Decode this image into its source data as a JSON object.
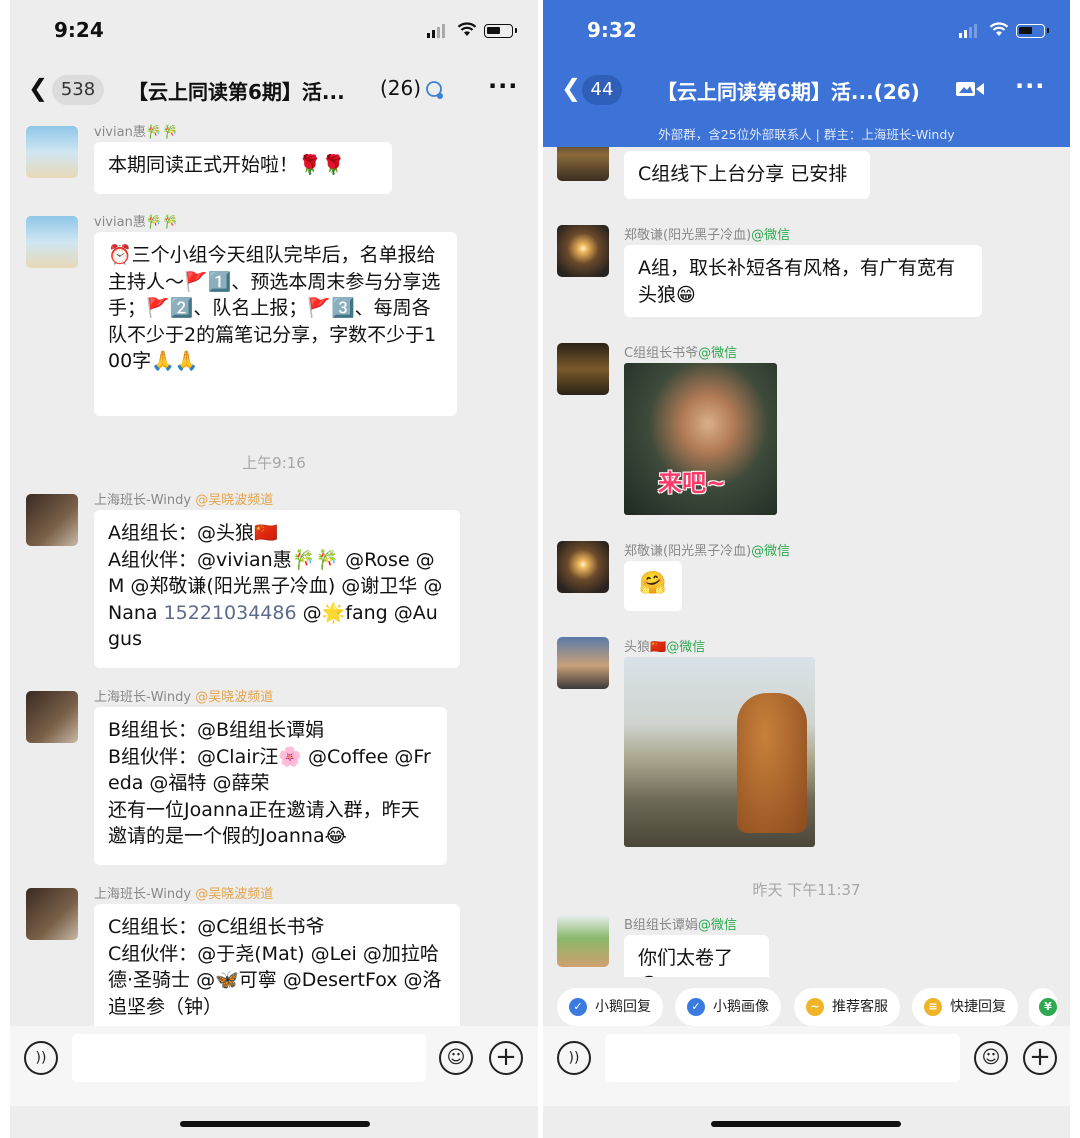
{
  "left": {
    "status": {
      "time": "9:24"
    },
    "nav": {
      "back_count": "538",
      "title": "【云上同读第6期】活...",
      "member_count": "(26)",
      "more": "···"
    },
    "messages": [
      {
        "sender": "vivian惠🎋🎋",
        "text": "本期同读正式开始啦！🌹🌹"
      },
      {
        "sender": "vivian惠🎋🎋",
        "text": "⏰三个小组今天组队完毕后，名单报给主持人～🚩1️⃣、预选本周末参与分享选手；🚩2️⃣、队名上报；🚩3️⃣、每周各队不少于2的篇笔记分享，字数不少于100字🙏🙏"
      },
      {
        "sender": "上海班长-Windy",
        "tag": "@吴晓波频道",
        "lines": [
          "A组组长：@头狼🇨🇳",
          "A组伙伴：@vivian惠🎋🎋 @Rose @M @郑敬谦(阳光黑子冷血) @谢卫华 @Nana "
        ],
        "phone": "15221034486",
        "tail": " @🌟fang @Augus"
      },
      {
        "sender": "上海班长-Windy",
        "tag": "@吴晓波频道",
        "text": "B组组长：@B组组长谭娟\nB组伙伴：@Clair汪🌸 @Coffee @Freda @福特 @薛荣\n还有一位Joanna正在邀请入群，昨天邀请的是一个假的Joanna😂"
      },
      {
        "sender": "上海班长-Windy",
        "tag": "@吴晓波频道",
        "text": "C组组长：@C组组长书爷\nC组伙伴：@于尧(Mat) @Lei @加拉哈德·圣骑士 @🦋可寧 @DesertFox @洛追坚参（钟）"
      }
    ],
    "timestamp": "上午9:16"
  },
  "right": {
    "status": {
      "time": "9:32"
    },
    "nav": {
      "back_count": "44",
      "title": "【云上同读第6期】活...(26)",
      "subtitle": "外部群，含25位外部联系人 | 群主：上海班长-Windy"
    },
    "messages": [
      {
        "text": "C组线下上台分享 已安排"
      },
      {
        "sender": "郑敬谦(阳光黑子冷血)",
        "wx": "@微信",
        "text": "A组，取长补短各有风格，有广有宽有头狼😁"
      },
      {
        "sender": "C组组长书爷",
        "wx": "@微信",
        "sticker_caption": "来吧~"
      },
      {
        "sender": "郑敬谦(阳光黑子冷血)",
        "wx": "@微信",
        "emoji": "🤗"
      },
      {
        "sender": "头狼🇨🇳",
        "wx": "@微信"
      },
      {
        "sender": "B组组长谭娟",
        "wx": "@微信",
        "text": "你们太卷了😭"
      }
    ],
    "timestamp": "昨天 下午11:37",
    "quick_replies": [
      "小鹅回复",
      "小鹅画像",
      "推荐客服",
      "快捷回复"
    ]
  },
  "colors": {
    "wecom_blue": "#3d73d6",
    "tag_orange": "#e3a34a",
    "wechat_green": "#2fa84f"
  }
}
